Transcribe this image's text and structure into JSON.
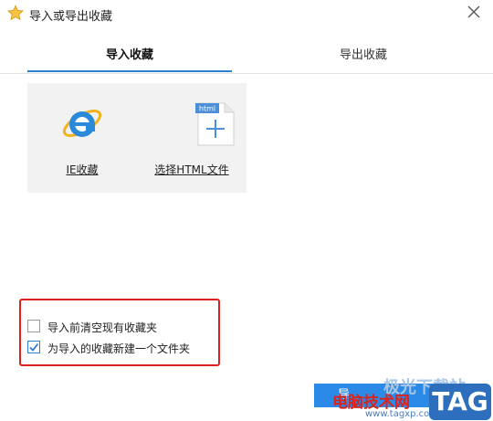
{
  "window": {
    "title": "导入或导出收藏",
    "close_icon": "close-icon",
    "title_icon": "star-icon"
  },
  "tabs": [
    {
      "label": "导入收藏",
      "active": true
    },
    {
      "label": "导出收藏",
      "active": false
    }
  ],
  "import_options": [
    {
      "label": "IE收藏",
      "icon": "ie-icon"
    },
    {
      "label": "选择HTML文件",
      "icon": "html-file-icon",
      "icon_tag": "html"
    }
  ],
  "options": [
    {
      "label": "导入前清空现有收藏夹",
      "checked": false
    },
    {
      "label": "为导入的收藏新建一个文件夹",
      "checked": true
    }
  ],
  "action_button": {
    "label": "导"
  },
  "watermark": {
    "line1": "极光下载站",
    "line2": "电脑技术网",
    "url": "www.tagxp.com",
    "badge": "TAG"
  },
  "colors": {
    "accent": "#2b7fd6",
    "highlight_box": "#e0201f",
    "panel_bg": "#f2f2f2"
  }
}
